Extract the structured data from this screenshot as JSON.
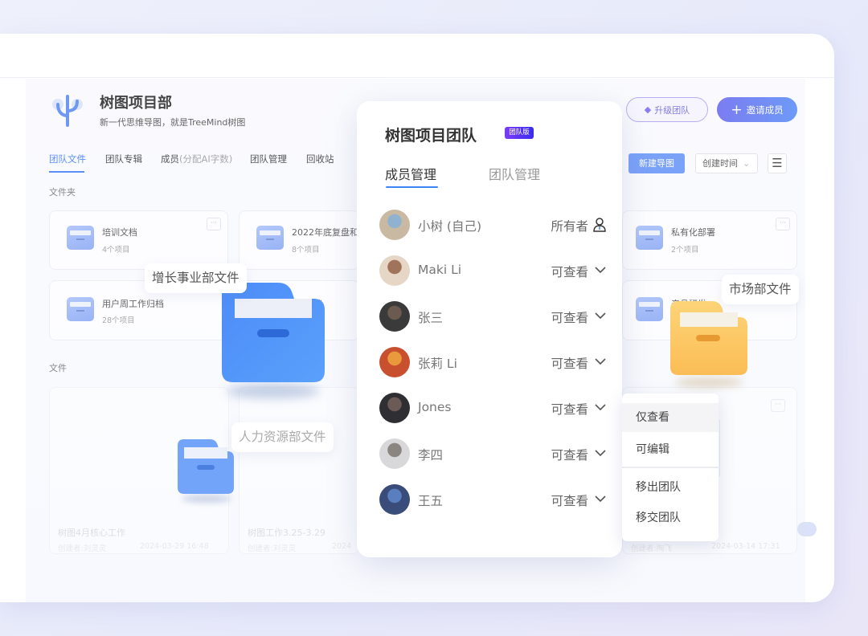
{
  "header": {
    "title": "树图项目部",
    "subtitle": "新一代思维导图，就是TreeMind树图",
    "upgrade_label": "升级团队",
    "invite_label": "邀请成员"
  },
  "tabs": [
    {
      "label": "团队文件",
      "active": true
    },
    {
      "label": "团队专辑"
    },
    {
      "label": "成员",
      "extra": "(分配AI字数)"
    },
    {
      "label": "团队管理"
    },
    {
      "label": "回收站"
    }
  ],
  "toolbar": {
    "new_label": "新建导图",
    "sort_label": "创建时间"
  },
  "folders_section": "文件夹",
  "folders": [
    {
      "name": "培训文档",
      "count": "4个项目"
    },
    {
      "name": "2022年底复盘和",
      "count": "8个项目"
    },
    {
      "name": "私有化部署",
      "count": "2个项目"
    },
    {
      "name": "用户周工作归档",
      "count": "28个项目"
    },
    {
      "name": "作归档",
      "count": ""
    },
    {
      "name": "产品研发",
      "count": ""
    }
  ],
  "files_section": "文件",
  "files": [
    {
      "name": "树图4月核心工作",
      "creator": "创建者:刘灵灵",
      "time": "2024-03-29 16:48"
    },
    {
      "name": "树图工作3.25-3.29",
      "creator": "创建者:刘灵灵",
      "time": "2024"
    },
    {
      "name": "",
      "creator": "创建者:陶飞",
      "time": "2024-03-14 17:31"
    }
  ],
  "panel": {
    "title": "树图项目团队",
    "badge": "团队版",
    "tabs": [
      {
        "label": "成员管理",
        "active": true
      },
      {
        "label": "团队管理"
      }
    ],
    "members": [
      {
        "name": "小树 (自己)",
        "role": "所有者",
        "icon": "user-icon"
      },
      {
        "name": "Maki Li",
        "role": "可查看",
        "icon": "chevron-down-icon"
      },
      {
        "name": "张三",
        "role": "可查看",
        "icon": "chevron-down-icon"
      },
      {
        "name": "张莉 Li",
        "role": "可查看",
        "icon": "chevron-down-icon"
      },
      {
        "name": "Jones",
        "role": "可查看",
        "icon": "chevron-down-icon"
      },
      {
        "name": "李四",
        "role": "可查看",
        "icon": "chevron-down-icon"
      },
      {
        "name": "王五",
        "role": "可查看",
        "icon": "chevron-down-icon"
      }
    ]
  },
  "dropdown": {
    "items": [
      "仅查看",
      "可编辑",
      "移出团队",
      "移交团队"
    ],
    "highlighted": "仅查看"
  },
  "floating_labels": {
    "growth": "增长事业部文件",
    "hr": "人力资源部文件",
    "market": "市场部文件"
  },
  "colors": {
    "accent": "#3d84f7",
    "invite": "#7b7cf0",
    "badge": "#5b30f2",
    "folder_blue": "#4a8cf7",
    "folder_yellow": "#fcc35b"
  }
}
